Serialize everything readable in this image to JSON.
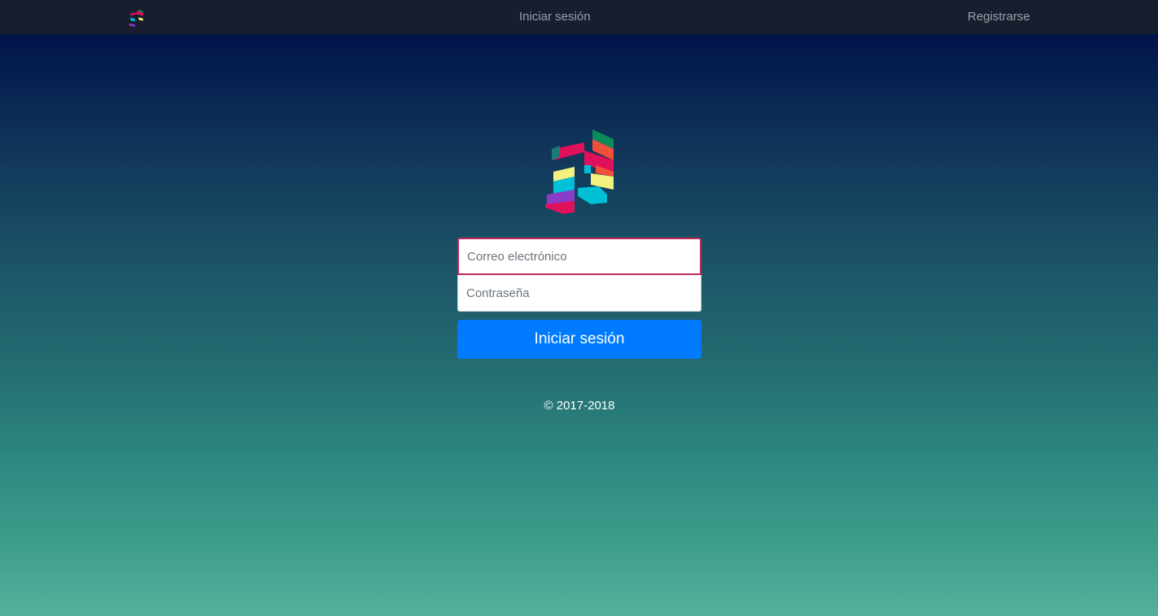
{
  "nav": {
    "logo_icon": "music-note-logo-icon",
    "login_label": "Iniciar sesión",
    "register_label": "Registrarse"
  },
  "hero": {
    "logo_icon": "music-note-logo-icon"
  },
  "form": {
    "email": {
      "value": "",
      "placeholder": "Correo electrónico"
    },
    "password": {
      "value": "",
      "placeholder": "Contraseña"
    },
    "submit_label": "Iniciar sesión"
  },
  "footer": {
    "copyright": "© 2017-2018"
  },
  "colors": {
    "topbar": "#181e2e",
    "primary_button": "#007bff",
    "focus_border": "#c02858",
    "gradient_top": "#01104a",
    "gradient_bottom": "#55b09b"
  }
}
